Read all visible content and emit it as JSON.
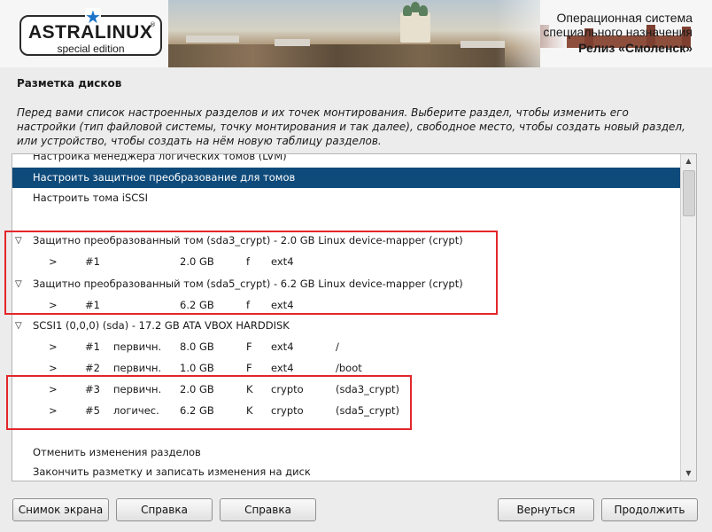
{
  "header": {
    "logo_text": "ASTRALINUX",
    "logo_reg": "®",
    "logo_sub": "special edition",
    "line1": "Операционная система",
    "line2": "специального назначения",
    "line3": "Релиз «Смоленск»"
  },
  "page": {
    "title": "Разметка дисков",
    "description": "Перед вами список настроенных разделов и их точек монтирования. Выберите раздел, чтобы изменить его настройки (тип файловой системы, точку монтирования и так далее), свободное место, чтобы создать новый раздел, или устройство, чтобы создать на нём новую таблицу разделов."
  },
  "list": {
    "lvm": "Настройка менеджера логических томов (LVM)",
    "crypt_config": "Настроить защитное преобразование для томов",
    "iscsi": "Настроить тома iSCSI",
    "crypt1": "Защитно преобразованный том (sda3_crypt) - 2.0 GB Linux device-mapper (crypt)",
    "crypt1_part": {
      "arrow": ">",
      "num": "#1",
      "size": "2.0 GB",
      "flag": "f",
      "fs": "ext4"
    },
    "crypt2": "Защитно преобразованный том (sda5_crypt) - 6.2 GB Linux device-mapper (crypt)",
    "crypt2_part": {
      "arrow": ">",
      "num": "#1",
      "size": "6.2 GB",
      "flag": "f",
      "fs": "ext4"
    },
    "disk": "SCSI1 (0,0,0) (sda) - 17.2 GB ATA VBOX HARDDISK",
    "partitions": [
      {
        "arrow": ">",
        "num": "#1",
        "type": "первичн.",
        "size": "8.0 GB",
        "flag": "F",
        "fs": "ext4",
        "mount": "/"
      },
      {
        "arrow": ">",
        "num": "#2",
        "type": "первичн.",
        "size": "1.0 GB",
        "flag": "F",
        "fs": "ext4",
        "mount": "/boot"
      },
      {
        "arrow": ">",
        "num": "#3",
        "type": "первичн.",
        "size": "2.0 GB",
        "flag": "K",
        "fs": "crypto",
        "mount": "(sda3_crypt)"
      },
      {
        "arrow": ">",
        "num": "#5",
        "type": "логичес.",
        "size": "6.2 GB",
        "flag": "K",
        "fs": "crypto",
        "mount": "(sda5_crypt)"
      }
    ],
    "undo": "Отменить изменения разделов",
    "finish": "Закончить разметку и записать изменения на диск"
  },
  "buttons": {
    "screenshot": "Снимок экрана",
    "help1": "Справка",
    "help2": "Справка",
    "back": "Вернуться",
    "continue": "Продолжить"
  },
  "colors": {
    "selection": "#0e4a7a",
    "highlight_box": "#e3262a",
    "logo_star": "#1d74c9"
  }
}
